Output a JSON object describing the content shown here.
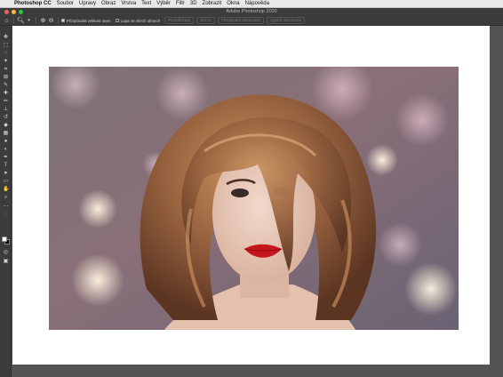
{
  "menubar": {
    "app_name": "Photoshop CC",
    "items": [
      "Soubor",
      "Úpravy",
      "Obraz",
      "Vrstva",
      "Text",
      "Výběr",
      "Filtr",
      "3D",
      "Zobrazit",
      "Okna",
      "Nápověda"
    ]
  },
  "window": {
    "title": "Adobe Photoshop 2020"
  },
  "options_bar": {
    "resize_windows_label": "Přizpůsobit velikost oken",
    "all_windows_label": "Lupa ve všech oknech",
    "scrubby_zoom_label": "Plynulá lupa",
    "btn_100": "100 %",
    "btn_fit": "Přizpůsobit obrazovce",
    "btn_fill": "Vyplnit obrazovku"
  },
  "colors": {
    "menubar": "#e8e8e8",
    "titlebar": "#3c3c3c",
    "workspace": "#535353",
    "document": "#ffffff",
    "close": "#ff5f57",
    "minimize": "#febc2e",
    "zoom": "#28c840"
  }
}
